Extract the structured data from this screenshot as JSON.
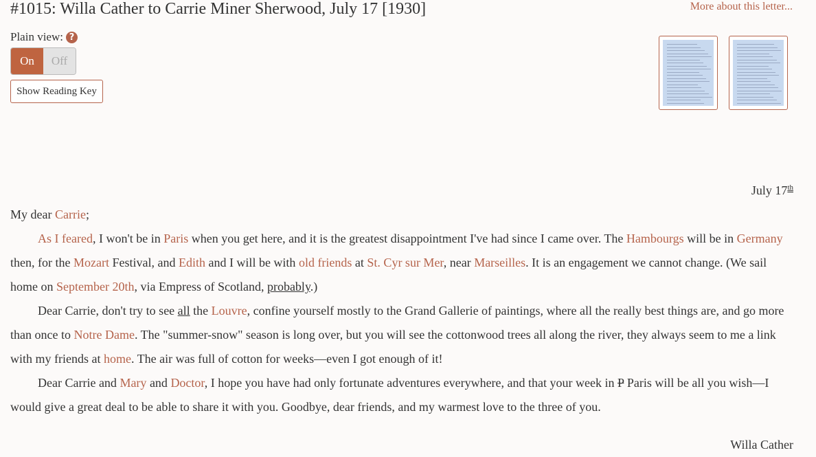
{
  "header": {
    "title": "#1015: Willa Cather to Carrie Miner Sherwood, July 17 [1930]",
    "more_link": "More about this letter...",
    "plain_view_label": "Plain view:",
    "help_icon": "?",
    "toggle_on": "On",
    "toggle_off": "Off",
    "reading_key_button": "Show Reading Key"
  },
  "thumbnails": [
    "page-1-thumbnail",
    "page-2-thumbnail"
  ],
  "letter": {
    "date": "July 17",
    "date_sup": "th",
    "salutation_pre": "My dear ",
    "salutation_name": "Carrie",
    "salutation_post": ";",
    "p1": [
      {
        "t": "As I feared",
        "ref": true
      },
      {
        "t": ", I won't be in "
      },
      {
        "t": "Paris",
        "ref": true
      },
      {
        "t": " when you get here, and it is the greatest disappointment I've had since I came over. The "
      },
      {
        "t": "Hambourgs",
        "ref": true
      },
      {
        "t": " will be in "
      },
      {
        "t": "Germany",
        "ref": true
      },
      {
        "t": " then, for the "
      },
      {
        "t": "Mozart",
        "ref": true
      },
      {
        "t": " Festival, and "
      },
      {
        "t": "Edith",
        "ref": true
      },
      {
        "t": " and I will be with "
      },
      {
        "t": "old friends",
        "ref": true
      },
      {
        "t": " at "
      },
      {
        "t": "St. Cyr sur Mer",
        "ref": true
      },
      {
        "t": ", near "
      },
      {
        "t": "Marseilles",
        "ref": true
      },
      {
        "t": ". It is an engagement we cannot change. (We sail home on "
      },
      {
        "t": "September 20th",
        "ref": true
      },
      {
        "t": ", via Empress of Scotland, "
      },
      {
        "t": "probably",
        "u": true
      },
      {
        "t": ".)"
      }
    ],
    "p2": [
      {
        "t": "Dear Carrie, don't try to see "
      },
      {
        "t": "all",
        "u": true
      },
      {
        "t": " the "
      },
      {
        "t": "Louvre",
        "ref": true
      },
      {
        "t": ", confine yourself mostly to the Grand Gallerie of paintings, where all the really best things are, and go more than once to "
      },
      {
        "t": "Notre Dame",
        "ref": true
      },
      {
        "t": ". The \"summer-snow\" season is long over, but you will see the cottonwood trees all along the river, they always seem to me a link with my friends at "
      },
      {
        "t": "home",
        "ref": true
      },
      {
        "t": ". The air was full of cotton for weeks—even I got enough of it!"
      }
    ],
    "p3": [
      {
        "t": "Dear Carrie and "
      },
      {
        "t": "Mary",
        "ref": true
      },
      {
        "t": " and "
      },
      {
        "t": "Doctor",
        "ref": true
      },
      {
        "t": ", I hope you have had only fortunate adventures everywhere, and that your week in "
      },
      {
        "t": "P",
        "strike": true
      },
      {
        "t": " Paris will be all you wish—I would give a great deal to be able to share it with you. Goodbye, dear friends, and my warmest love to the three of you."
      }
    ],
    "signature": "Willa Cather"
  }
}
